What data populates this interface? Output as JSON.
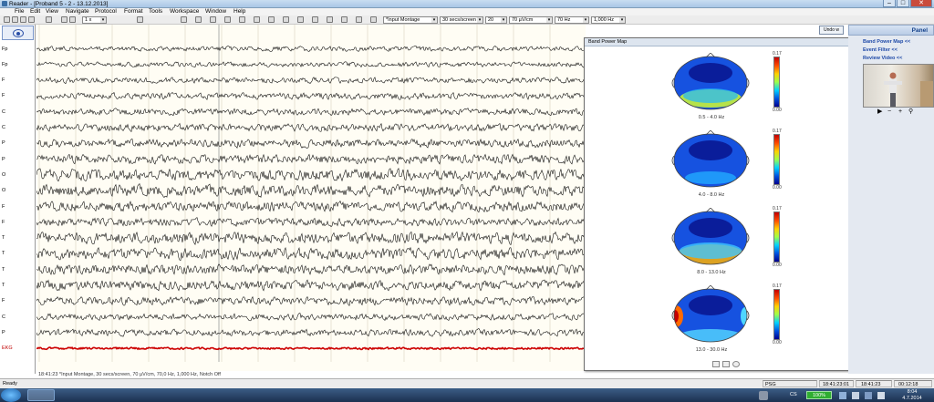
{
  "window": {
    "title": "Reader - [Proband 5 - 2 - 13.12.2013]",
    "minimize_glyph": "–",
    "maximize_glyph": "□",
    "close_glyph": "✕"
  },
  "menu": [
    "File",
    "Edit",
    "View",
    "Navigate",
    "Protocol",
    "Format",
    "Tools",
    "Workspace",
    "Window",
    "Help"
  ],
  "toolbar": {
    "speed": "1 x",
    "montage": "*Input Montage",
    "timebase": "30 secs/screen",
    "channels": "20",
    "sensitivity": "70 µV/cm",
    "lowpass": "70 Hz",
    "highpass": "1,000 Hz"
  },
  "channels": [
    {
      "label": "Fp",
      "color": "#000000"
    },
    {
      "label": "Fp",
      "color": "#000000"
    },
    {
      "label": "F",
      "color": "#000000"
    },
    {
      "label": "F",
      "color": "#000000"
    },
    {
      "label": "C",
      "color": "#000000"
    },
    {
      "label": "C",
      "color": "#000000"
    },
    {
      "label": "P",
      "color": "#000000"
    },
    {
      "label": "P",
      "color": "#000000"
    },
    {
      "label": "O",
      "color": "#000000"
    },
    {
      "label": "O",
      "color": "#000000"
    },
    {
      "label": "F",
      "color": "#000000"
    },
    {
      "label": "F",
      "color": "#000000"
    },
    {
      "label": "T",
      "color": "#000000"
    },
    {
      "label": "T",
      "color": "#000000"
    },
    {
      "label": "T",
      "color": "#000000"
    },
    {
      "label": "T",
      "color": "#000000"
    },
    {
      "label": "F",
      "color": "#000000"
    },
    {
      "label": "C",
      "color": "#000000"
    },
    {
      "label": "P",
      "color": "#000000"
    },
    {
      "label": "EKG",
      "color": "#cc0000"
    }
  ],
  "eeg_footer": "18:41:23 *Input Montage, 30 secs/screen, 70 µV/cm, 70,0 Hz, 1,000 Hz, Notch Off",
  "band_power": {
    "title": "Band Power Map",
    "scale_max": "0.17",
    "scale_min": "0.00",
    "maps": [
      {
        "band": "0.5 - 4.0 Hz"
      },
      {
        "band": "4.0 - 8.0 Hz"
      },
      {
        "band": "8.0 - 13.0 Hz"
      },
      {
        "band": "13.0 - 30.0 Hz"
      }
    ]
  },
  "panel": {
    "header": "Panel",
    "button": "Undo w",
    "links": [
      "Band Power Map <<",
      "Event Filter <<",
      "Review Video <<"
    ]
  },
  "status": {
    "left": "Ready",
    "mode": "PSG",
    "time1": "18:41:23:01",
    "time2": "18:41:23",
    "duration": "00:12:18"
  },
  "taskbar": {
    "lang": "CS",
    "battery": "100%",
    "time": "8:04",
    "date": "4.7.2014"
  }
}
